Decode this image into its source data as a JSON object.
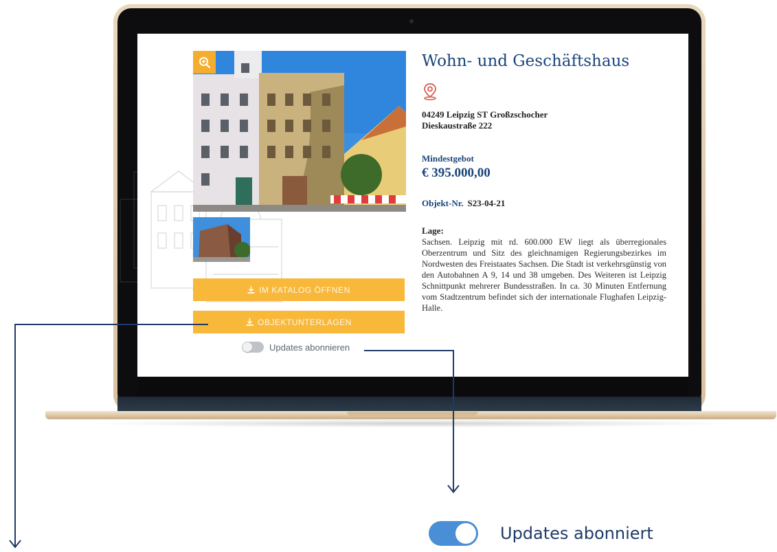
{
  "listing": {
    "title": "Wohn- und Geschäftshaus",
    "address_line1": "04249 Leipzig ST Großzschocher",
    "address_line2": "Dieskaustraße 222",
    "min_bid_label": "Mindestgebot",
    "min_bid_value": "€ 395.000,00",
    "object_no_label": "Objekt-Nr.",
    "object_no_value": "S23-04-21",
    "location_label": "Lage:",
    "location_text": "Sachsen. Leipzig mit rd. 600.000 EW liegt als überregionales Oberzentrum und Sitz des gleichnamigen Regierungsbezirkes im Nordwesten des Freistaates Sachsen. Die Stadt ist verkehrsgünstig von den Autobahnen A 9, 14 und 38 umgeben. Des Weiteren ist Leipzig Schnittpunkt mehrerer Bundesstraßen. In ca. 30 Minuten Entfernung vom Stadtzentrum befindet sich der internationale Flughafen Leipzig-Halle."
  },
  "actions": {
    "catalog_label": "IM KATALOG ÖFFNEN",
    "documents_label": "OBJEKTUNTERLAGEN",
    "subscribe_label": "Updates abonnieren",
    "subscribe_on": false
  },
  "callout": {
    "subscribed_label": "Updates abonniert",
    "subscribed_on": true
  },
  "icons": {
    "zoom": "zoom-in-icon",
    "location": "map-pin-icon",
    "download": "download-icon"
  },
  "colors": {
    "brand_blue": "#18457a",
    "accent_orange": "#f8b83a",
    "toggle_on": "#4a8fd6",
    "toggle_off": "#bfc3c8"
  }
}
